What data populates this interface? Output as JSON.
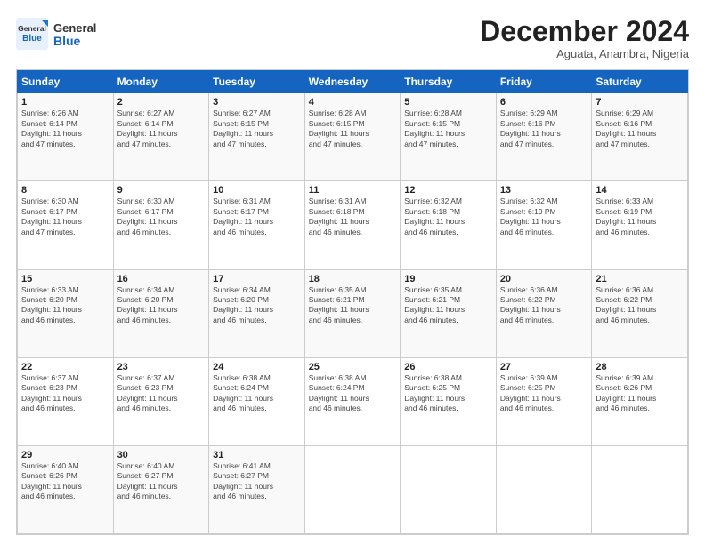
{
  "header": {
    "logo_line1": "General",
    "logo_line2": "Blue",
    "month": "December 2024",
    "location": "Aguata, Anambra, Nigeria"
  },
  "columns": [
    "Sunday",
    "Monday",
    "Tuesday",
    "Wednesday",
    "Thursday",
    "Friday",
    "Saturday"
  ],
  "weeks": [
    [
      {
        "day": "1",
        "info": "Sunrise: 6:26 AM\nSunset: 6:14 PM\nDaylight: 11 hours\nand 47 minutes."
      },
      {
        "day": "2",
        "info": "Sunrise: 6:27 AM\nSunset: 6:14 PM\nDaylight: 11 hours\nand 47 minutes."
      },
      {
        "day": "3",
        "info": "Sunrise: 6:27 AM\nSunset: 6:15 PM\nDaylight: 11 hours\nand 47 minutes."
      },
      {
        "day": "4",
        "info": "Sunrise: 6:28 AM\nSunset: 6:15 PM\nDaylight: 11 hours\nand 47 minutes."
      },
      {
        "day": "5",
        "info": "Sunrise: 6:28 AM\nSunset: 6:15 PM\nDaylight: 11 hours\nand 47 minutes."
      },
      {
        "day": "6",
        "info": "Sunrise: 6:29 AM\nSunset: 6:16 PM\nDaylight: 11 hours\nand 47 minutes."
      },
      {
        "day": "7",
        "info": "Sunrise: 6:29 AM\nSunset: 6:16 PM\nDaylight: 11 hours\nand 47 minutes."
      }
    ],
    [
      {
        "day": "8",
        "info": "Sunrise: 6:30 AM\nSunset: 6:17 PM\nDaylight: 11 hours\nand 47 minutes."
      },
      {
        "day": "9",
        "info": "Sunrise: 6:30 AM\nSunset: 6:17 PM\nDaylight: 11 hours\nand 46 minutes."
      },
      {
        "day": "10",
        "info": "Sunrise: 6:31 AM\nSunset: 6:17 PM\nDaylight: 11 hours\nand 46 minutes."
      },
      {
        "day": "11",
        "info": "Sunrise: 6:31 AM\nSunset: 6:18 PM\nDaylight: 11 hours\nand 46 minutes."
      },
      {
        "day": "12",
        "info": "Sunrise: 6:32 AM\nSunset: 6:18 PM\nDaylight: 11 hours\nand 46 minutes."
      },
      {
        "day": "13",
        "info": "Sunrise: 6:32 AM\nSunset: 6:19 PM\nDaylight: 11 hours\nand 46 minutes."
      },
      {
        "day": "14",
        "info": "Sunrise: 6:33 AM\nSunset: 6:19 PM\nDaylight: 11 hours\nand 46 minutes."
      }
    ],
    [
      {
        "day": "15",
        "info": "Sunrise: 6:33 AM\nSunset: 6:20 PM\nDaylight: 11 hours\nand 46 minutes."
      },
      {
        "day": "16",
        "info": "Sunrise: 6:34 AM\nSunset: 6:20 PM\nDaylight: 11 hours\nand 46 minutes."
      },
      {
        "day": "17",
        "info": "Sunrise: 6:34 AM\nSunset: 6:20 PM\nDaylight: 11 hours\nand 46 minutes."
      },
      {
        "day": "18",
        "info": "Sunrise: 6:35 AM\nSunset: 6:21 PM\nDaylight: 11 hours\nand 46 minutes."
      },
      {
        "day": "19",
        "info": "Sunrise: 6:35 AM\nSunset: 6:21 PM\nDaylight: 11 hours\nand 46 minutes."
      },
      {
        "day": "20",
        "info": "Sunrise: 6:36 AM\nSunset: 6:22 PM\nDaylight: 11 hours\nand 46 minutes."
      },
      {
        "day": "21",
        "info": "Sunrise: 6:36 AM\nSunset: 6:22 PM\nDaylight: 11 hours\nand 46 minutes."
      }
    ],
    [
      {
        "day": "22",
        "info": "Sunrise: 6:37 AM\nSunset: 6:23 PM\nDaylight: 11 hours\nand 46 minutes."
      },
      {
        "day": "23",
        "info": "Sunrise: 6:37 AM\nSunset: 6:23 PM\nDaylight: 11 hours\nand 46 minutes."
      },
      {
        "day": "24",
        "info": "Sunrise: 6:38 AM\nSunset: 6:24 PM\nDaylight: 11 hours\nand 46 minutes."
      },
      {
        "day": "25",
        "info": "Sunrise: 6:38 AM\nSunset: 6:24 PM\nDaylight: 11 hours\nand 46 minutes."
      },
      {
        "day": "26",
        "info": "Sunrise: 6:38 AM\nSunset: 6:25 PM\nDaylight: 11 hours\nand 46 minutes."
      },
      {
        "day": "27",
        "info": "Sunrise: 6:39 AM\nSunset: 6:25 PM\nDaylight: 11 hours\nand 46 minutes."
      },
      {
        "day": "28",
        "info": "Sunrise: 6:39 AM\nSunset: 6:26 PM\nDaylight: 11 hours\nand 46 minutes."
      }
    ],
    [
      {
        "day": "29",
        "info": "Sunrise: 6:40 AM\nSunset: 6:26 PM\nDaylight: 11 hours\nand 46 minutes."
      },
      {
        "day": "30",
        "info": "Sunrise: 6:40 AM\nSunset: 6:27 PM\nDaylight: 11 hours\nand 46 minutes."
      },
      {
        "day": "31",
        "info": "Sunrise: 6:41 AM\nSunset: 6:27 PM\nDaylight: 11 hours\nand 46 minutes."
      },
      {
        "day": "",
        "info": ""
      },
      {
        "day": "",
        "info": ""
      },
      {
        "day": "",
        "info": ""
      },
      {
        "day": "",
        "info": ""
      }
    ]
  ]
}
